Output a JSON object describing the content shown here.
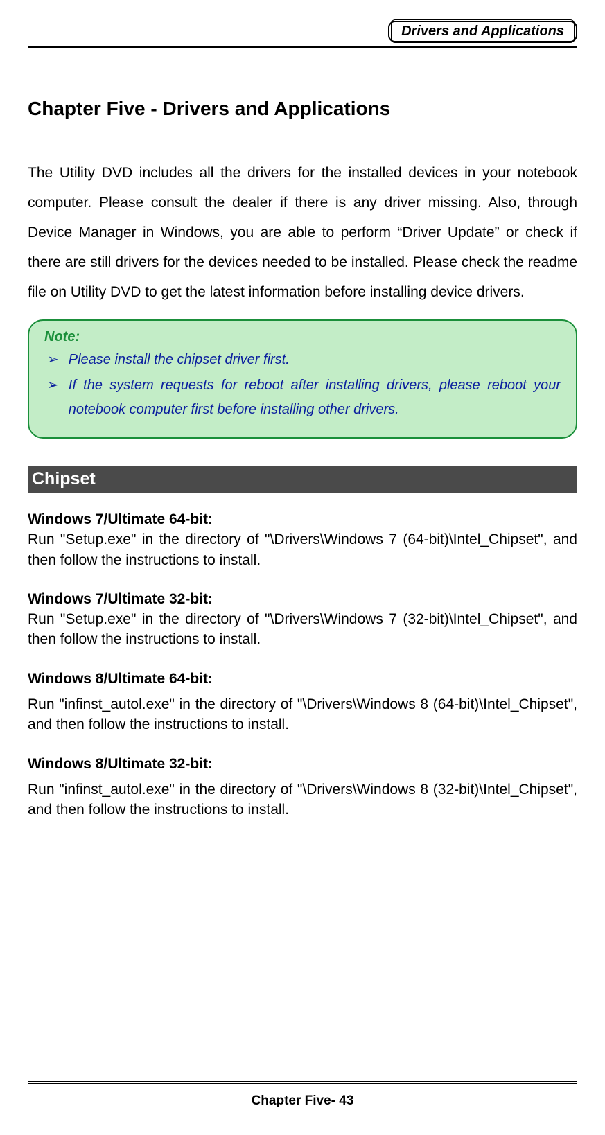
{
  "header": {
    "badge": "Drivers and Applications"
  },
  "chapter_title": "Chapter Five - Drivers and Applications",
  "intro": "The Utility DVD includes all the drivers for the installed devices in your notebook computer. Please consult the dealer if there is any driver missing. Also, through Device Manager in Windows, you are able to perform “Driver Update” or check if there are still drivers for the devices needed to be installed. Please check the readme file on Utility DVD to get the latest information before installing device drivers.",
  "note": {
    "label": "Note:",
    "items": [
      "Please install the chipset driver first.",
      "If the system requests for reboot after installing drivers, please reboot your notebook computer first before installing other drivers."
    ]
  },
  "section": {
    "title": " Chipset"
  },
  "drivers": [
    {
      "heading": "Windows 7/Ultimate 64-bit:",
      "text": "Run \"Setup.exe\" in the directory of \"\\Drivers\\Windows 7 (64-bit)\\Intel_Chipset\", and then follow the instructions to install."
    },
    {
      "heading": "Windows 7/Ultimate 32-bit:",
      "text": "Run \"Setup.exe\" in the directory of \"\\Drivers\\Windows 7 (32-bit)\\Intel_Chipset\", and then follow the instructions to install."
    },
    {
      "heading": "Windows 8/Ultimate 64-bit:",
      "text": "Run \"infinst_autol.exe\" in the directory of \"\\Drivers\\Windows 8 (64-bit)\\Intel_Chipset\", and then follow the instructions to install."
    },
    {
      "heading": "Windows 8/Ultimate 32-bit:",
      "text": "Run \"infinst_autol.exe\" in the directory of \"\\Drivers\\Windows 8 (32-bit)\\Intel_Chipset\", and then follow the instructions to install."
    }
  ],
  "footer": "Chapter Five- 43"
}
